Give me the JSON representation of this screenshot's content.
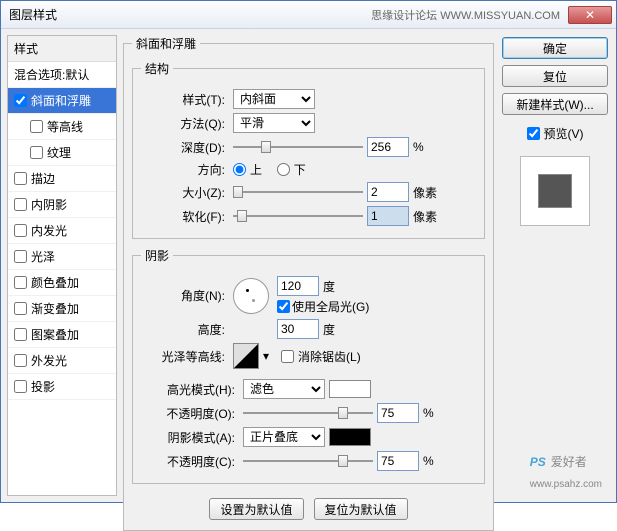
{
  "window": {
    "title": "图层样式",
    "subtitle": "思缘设计论坛 WWW.MISSYUAN.COM"
  },
  "sidebar": {
    "header": "样式",
    "blend": "混合选项:默认",
    "items": [
      {
        "label": "斜面和浮雕",
        "checked": true,
        "selected": true
      },
      {
        "label": "等高线",
        "checked": false,
        "sub": true
      },
      {
        "label": "纹理",
        "checked": false,
        "sub": true
      },
      {
        "label": "描边",
        "checked": false
      },
      {
        "label": "内阴影",
        "checked": false
      },
      {
        "label": "内发光",
        "checked": false
      },
      {
        "label": "光泽",
        "checked": false
      },
      {
        "label": "颜色叠加",
        "checked": false
      },
      {
        "label": "渐变叠加",
        "checked": false
      },
      {
        "label": "图案叠加",
        "checked": false
      },
      {
        "label": "外发光",
        "checked": false
      },
      {
        "label": "投影",
        "checked": false
      }
    ]
  },
  "bevel": {
    "group": "斜面和浮雕",
    "structure": "结构",
    "style_lbl": "样式(T):",
    "style_val": "内斜面",
    "technique_lbl": "方法(Q):",
    "technique_val": "平滑",
    "depth_lbl": "深度(D):",
    "depth_val": "256",
    "pct": "%",
    "direction_lbl": "方向:",
    "up": "上",
    "down": "下",
    "size_lbl": "大小(Z):",
    "size_val": "2",
    "px": "像素",
    "soften_lbl": "软化(F):",
    "soften_val": "1",
    "shading": "阴影",
    "angle_lbl": "角度(N):",
    "angle_val": "120",
    "deg": "度",
    "global": "使用全局光(G)",
    "altitude_lbl": "高度:",
    "altitude_val": "30",
    "gloss_lbl": "光泽等高线:",
    "anti": "消除锯齿(L)",
    "highlight_lbl": "高光模式(H):",
    "highlight_val": "滤色",
    "opacity_lbl": "不透明度(O):",
    "opacity_val": "75",
    "shadow_lbl": "阴影模式(A):",
    "shadow_val": "正片叠底",
    "opacity2_lbl": "不透明度(C):",
    "opacity2_val": "75",
    "default_btn": "设置为默认值",
    "reset_btn": "复位为默认值"
  },
  "right": {
    "ok": "确定",
    "cancel": "复位",
    "newstyle": "新建样式(W)...",
    "preview": "预览(V)"
  },
  "watermark": {
    "logo": "PS",
    "cn": "爱好者",
    "url": "www.psahz.com"
  }
}
